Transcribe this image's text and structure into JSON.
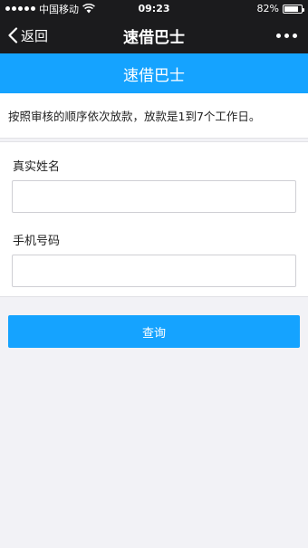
{
  "status_bar": {
    "carrier": "中国移动",
    "time": "09:23",
    "battery_percent": "82%",
    "battery_level": 0.82
  },
  "nav": {
    "back_label": "返回",
    "title": "速借巴士"
  },
  "banner": {
    "title": "速借巴士"
  },
  "notice": {
    "text": "按照审核的顺序依次放款，放款是1到7个工作日。"
  },
  "form": {
    "name_label": "真实姓名",
    "name_value": "",
    "phone_label": "手机号码",
    "phone_value": ""
  },
  "actions": {
    "query_label": "查询"
  },
  "colors": {
    "accent": "#15a3ff",
    "bar": "#1b1b1d",
    "background": "#f2f2f6"
  }
}
